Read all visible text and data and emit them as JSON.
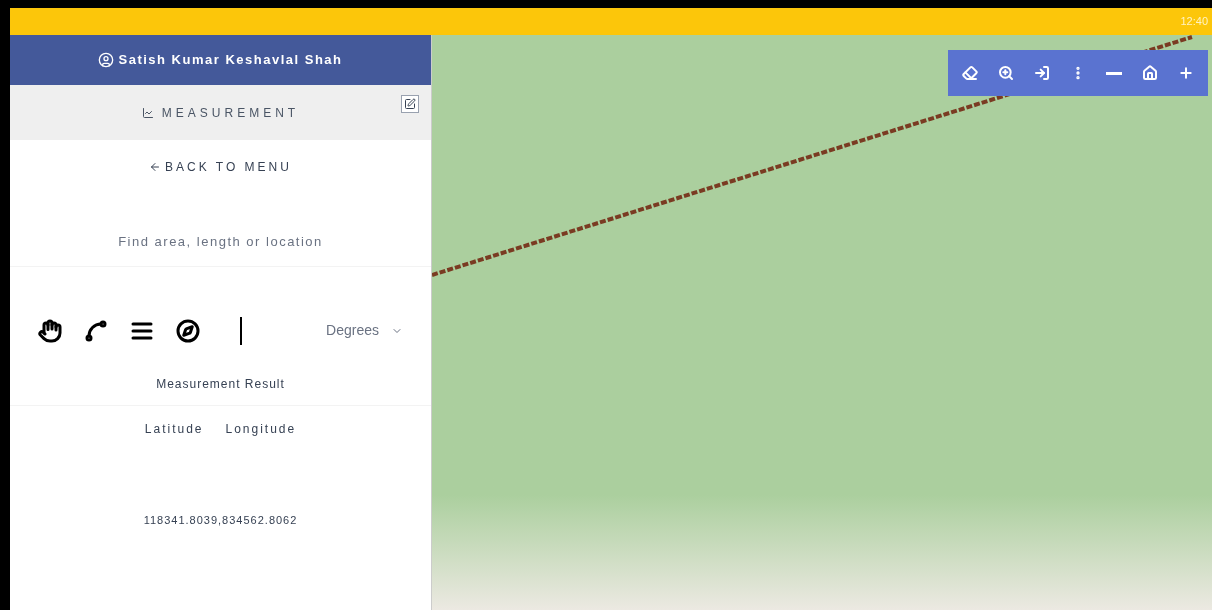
{
  "status_bar": {
    "time": "12:40"
  },
  "sidebar": {
    "user": "Satish Kumar Keshavlal Shah",
    "section": "MEASUREMENT",
    "back": "BACK TO MENU",
    "hint": "Find area, length or location",
    "unit_select": {
      "value": "Degrees"
    },
    "result_title": "Measurement Result",
    "columns": [
      "Latitude",
      "Longitude"
    ],
    "result": "118341.8039,834562.8062"
  }
}
